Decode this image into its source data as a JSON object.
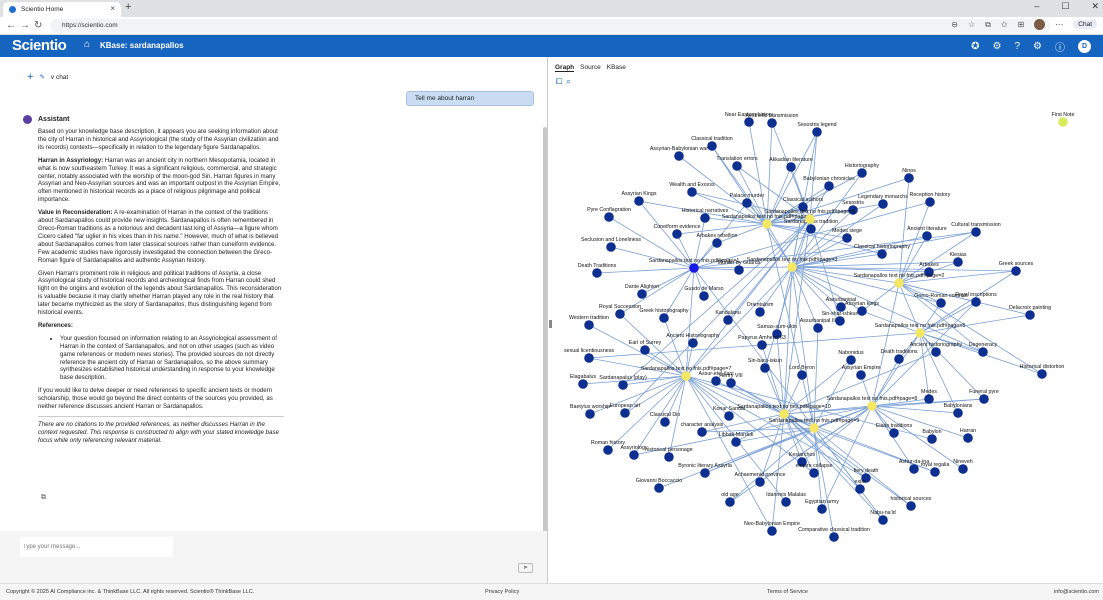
{
  "browser": {
    "tab_title": "Scientio Home",
    "url": "https://scientio.com",
    "chat_button": "Chat"
  },
  "app": {
    "logo": "Scientio",
    "kb_title": "KBase: sardanapallos",
    "user_initial": "D"
  },
  "chat": {
    "new_chat_label": "v chat",
    "user_message": "Tell me about harran",
    "assistant_label": "Assistant",
    "intro": "Based on your knowledge base description, it appears you are seeking information about the city of Harran in historical and Assyriological (the study of the Assyrian civilization and its records) contexts—specifically in relation to the legendary figure Sardanapallos.",
    "harran_heading": "Harran in Assyriology:",
    "harran_text": " Harran was an ancient city in northern Mesopotamia, located in what is now southeastern Turkey. It was a significant religious, commercial, and strategic center, notably associated with the worship of the moon-god Sin. Harran figures in many Assyrian and Neo-Assyrian sources and was an important outpost in the Assyrian Empire, often mentioned in historical records as a place of religious pilgrimage and political importance.",
    "value_heading": "Value in Reconsideration:",
    "value_text": " A re-examination of Harran in the context of the traditions about Sardanapallos could provide new insights. Sardanapallos is often remembered in Greco-Roman traditions as a notorious and decadent last king of Assyria—a figure whom Cicero called \"far uglier in his vices than in his name.\" However, much of what is believed about Sardanapallos comes from later classical sources rather than cuneiform evidence. Few academic studies have rigorously investigated the connection between the Greco-Roman figure of Sardanapallos and authentic Assyrian history.",
    "para3": "Given Harran's prominent role in religious and political traditions of Assyria, a close Assyriological study of historical records and archeological finds from Harran could shed light on the origins and evolution of the legends about Sardanapallos. This reconsideration is valuable because it may clarify whether Harran played any role in the real history that later became mythicized as the story of Sardanapallos, thus distinguishing legend from historical events.",
    "refs_heading": "References:",
    "refs_item": "Your question focused on information relating to an Assyriological assessment of Harran in the context of Sardanapallos, and not on other usages (such as video game references or modern news stories). The provided sources do not directly reference the ancient city of Harran or Sardanapallos, so the above summary synthesizes established historical understanding in response to your knowledge base description.",
    "para4": "If you would like to delve deeper or need references to specific ancient texts or modern scholarship, those would go beyond the direct contents of the sources you provided, as neither reference discusses ancient Harran or Sardanapallos.",
    "note": "There are no citations to the provided references, as neither discusses Harran in the context requested. This response is constructed to align with your stated knowledge base focus while only referencing relevant material.",
    "input_placeholder": "Type your message..."
  },
  "graph_panel": {
    "tabs": [
      "Graph",
      "Source",
      "KBase"
    ],
    "colors": {
      "node": "#0d2f8f",
      "hub": "#f5e663",
      "highlight": "#1a18e6",
      "edge": "#7aa0d6",
      "first_note": "#d7ec5a"
    },
    "hubs": [
      "Sardanapallos text no fnis.pdf#page=4",
      "Sardanapallos text no fnis.pdf#page=1",
      "Sardanapallos text no fnis.pdf#page=3",
      "Sardanapallos text no fnis.pdf#page=2",
      "Sardanapallos text no fnis.pdf#page=5",
      "Sardanapallos text no fnis.pdf#page=10",
      "Sardanapallos text no fnis.pdf#page=8",
      "Sardanapallos text no fnis.pdf#page=7",
      "Sardanapallos text no fnis.pdf#page=9",
      "Sardanapallos text no fnis.pdf#page=6"
    ],
    "first_note": "First Note",
    "highlight": "Sardanapallos text no fnis.pdf#page=1",
    "nodes": [
      "Near Eastern history",
      "Aesthetic transmission",
      "Sesostris legend",
      "Classical tradition",
      "Assyrian-Babylonian war",
      "Translation errors",
      "Akkadian literature",
      "Historiography",
      "Ninos",
      "Babylonian chronicles",
      "Wealth and Excess",
      "Assyrian Kings",
      "Palace murder",
      "Classical authors",
      "Sesostris",
      "Legendary monarchs",
      "Reception history",
      "Historical narratives",
      "Pyre Conflagration",
      "Cuneiform evidence",
      "Sardanapallos tradition",
      "Ancient literature",
      "Cultural transmission",
      "Medes siege",
      "Arbakes rebellion",
      "Seclusion and Loneliness",
      "Classical historiography",
      "Klesias",
      "Greek sources",
      "Death Traditions",
      "Murder by Guards",
      "Arbakes",
      "Dante Alighieri",
      "Gusdo de Marso",
      "Royal inscriptions",
      "Greco-Roman contrast",
      "Assurbanipal",
      "Orientalism",
      "Assyrian kings",
      "Delacroix painting",
      "Royal Succession",
      "Greek historiography",
      "Kandalanu",
      "Sin-shar-ishkun",
      "Western tradition",
      "Assurbanipal III",
      "Samas-sum-ukin",
      "Degeneracy",
      "Ancient Historiography",
      "Papyrus Amherst 63",
      "Ancient historiography",
      "Earl of Surrey",
      "sexual licentiousness",
      "Death traditions",
      "Nabonidus",
      "Assyrian Empire",
      "Historical distortion",
      "Sin-bara-iskun",
      "Lord Byron",
      "Assur-etel-ilani",
      "Elagabalus",
      "Sardanapalus (play)",
      "Henry VIII",
      "Medes",
      "Funeral pyre",
      "Babylonians",
      "Baetylus worship",
      "European art",
      "Classical Dio",
      "Konar Sandal",
      "Babylon",
      "Harran",
      "character analysis",
      "Libbali-Marduk",
      "Elaite traditions",
      "Roman history",
      "historical personage",
      "Assyriology",
      "Nineveh",
      "Ashur-da-ina",
      "royal regalia",
      "Kesiarchos",
      "empire collapse",
      "Byronic literary Assyria",
      "fiery death",
      "Giovanni Boccaccio",
      "Achaemenid province",
      "exile",
      "old age",
      "historical sources",
      "Idanneis Malalas",
      "Egyptian army",
      "Nabu-na'id",
      "Neo-Babylonian Empire",
      "Comparative classical tradition",
      "Kameros",
      "Assyrian royal line"
    ]
  },
  "footer": {
    "copyright": "Copyright © 2025 AI Compliance inc. & ThinkBase LLC. All rights reserved. Scientio® ThinkBase LLC.",
    "privacy": "Privacy Policy",
    "terms": "Terms of Service",
    "email": "info@scientio.com"
  }
}
